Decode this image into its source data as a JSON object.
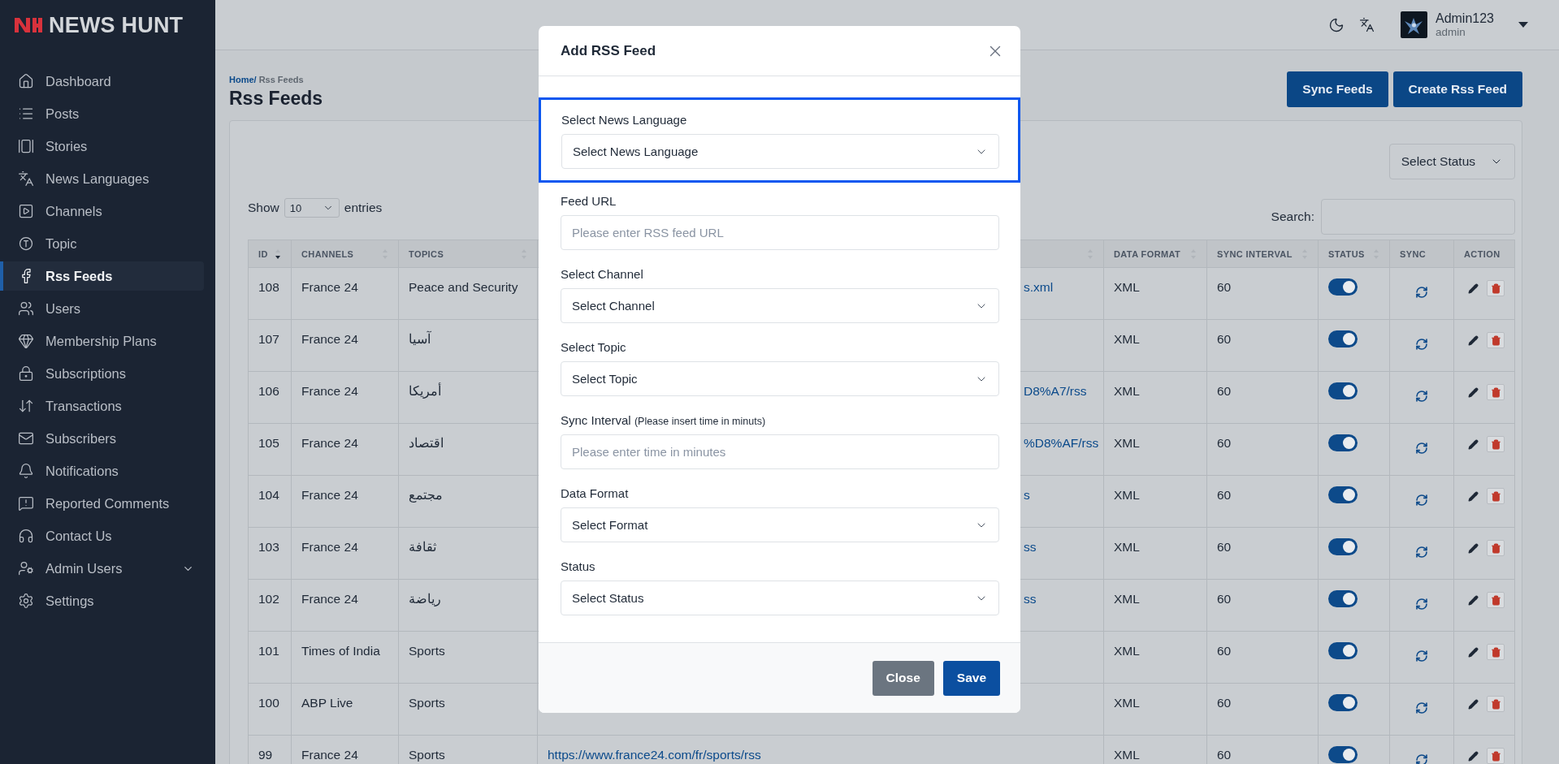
{
  "brand": {
    "name": "NEWS HUNT"
  },
  "sidebar": {
    "items": [
      {
        "label": "Dashboard",
        "selected": false,
        "kind": "link"
      },
      {
        "label": "Posts",
        "selected": false,
        "kind": "link"
      },
      {
        "label": "Stories",
        "selected": false,
        "kind": "link"
      },
      {
        "label": "News Languages",
        "selected": false,
        "kind": "link"
      },
      {
        "label": "Channels",
        "selected": false,
        "kind": "link"
      },
      {
        "label": "Topic",
        "selected": false,
        "kind": "link"
      },
      {
        "label": "Rss Feeds",
        "selected": true,
        "kind": "link"
      },
      {
        "label": "Users",
        "selected": false,
        "kind": "link"
      },
      {
        "label": "Membership Plans",
        "selected": false,
        "kind": "link"
      },
      {
        "label": "Subscriptions",
        "selected": false,
        "kind": "link"
      },
      {
        "label": "Transactions",
        "selected": false,
        "kind": "link"
      },
      {
        "label": "Subscribers",
        "selected": false,
        "kind": "link"
      },
      {
        "label": "Notifications",
        "selected": false,
        "kind": "link"
      },
      {
        "label": "Reported Comments",
        "selected": false,
        "kind": "link"
      },
      {
        "label": "Contact Us",
        "selected": false,
        "kind": "link"
      },
      {
        "label": "Admin Users",
        "selected": false,
        "kind": "group"
      },
      {
        "label": "Settings",
        "selected": false,
        "kind": "link"
      }
    ]
  },
  "user": {
    "name": "Admin123",
    "role": "admin"
  },
  "page": {
    "breadcrumb_home": "Home/",
    "breadcrumb_current": "Rss Feeds",
    "title": "Rss Feeds",
    "buttons": [
      "Sync Feeds",
      "Create Rss Feed"
    ]
  },
  "filters": {
    "status": "Select Status",
    "show_label": "Show",
    "entries_value": "10",
    "entries_label": "entries",
    "search_label": "Search:"
  },
  "table": {
    "columns": [
      {
        "label": "ID",
        "sortable": true,
        "sorted": true
      },
      {
        "label": "CHANNELS",
        "sortable": true,
        "sorted": false
      },
      {
        "label": "TOPICS",
        "sortable": true,
        "sorted": false
      },
      {
        "sortable": true,
        "sorted": false
      },
      {
        "label": "DATA FORMAT",
        "sortable": true,
        "sorted": false
      },
      {
        "label": "SYNC INTERVAL",
        "sortable": true,
        "sorted": false
      },
      {
        "label": "STATUS",
        "sortable": true,
        "sorted": false
      },
      {
        "label": "SYNC",
        "sortable": false
      },
      {
        "label": "ACTION",
        "sortable": false
      }
    ],
    "rows": [
      {
        "id": "108",
        "channel": "France 24",
        "topic": "Peace and Security",
        "url": {
          "text": "s.xml",
          "covered": true
        },
        "format": "XML",
        "interval": "60",
        "status": true
      },
      {
        "id": "107",
        "channel": "France 24",
        "topic": "آسيا",
        "format": "XML",
        "interval": "60",
        "status": true
      },
      {
        "id": "106",
        "channel": "France 24",
        "topic": "أمريكا",
        "url": {
          "text": "D8%A7/rss",
          "covered": true
        },
        "format": "XML",
        "interval": "60",
        "status": true
      },
      {
        "id": "105",
        "channel": "France 24",
        "topic": "اقتصاد",
        "url": {
          "text": "%D8%AF/rss",
          "covered": true
        },
        "format": "XML",
        "interval": "60",
        "status": true
      },
      {
        "id": "104",
        "channel": "France 24",
        "topic": "مجتمع",
        "url": {
          "text": "s",
          "covered": true
        },
        "format": "XML",
        "interval": "60",
        "status": true
      },
      {
        "id": "103",
        "channel": "France 24",
        "topic": "ثقافة",
        "url": {
          "text": "ss",
          "covered": true
        },
        "format": "XML",
        "interval": "60",
        "status": true
      },
      {
        "id": "102",
        "channel": "France 24",
        "topic": "رياضة",
        "url": {
          "text": "ss",
          "covered": true
        },
        "format": "XML",
        "interval": "60",
        "status": true
      },
      {
        "id": "101",
        "channel": "Times of India",
        "topic": "Sports",
        "format": "XML",
        "interval": "60",
        "status": true
      },
      {
        "id": "100",
        "channel": "ABP Live",
        "topic": "Sports",
        "format": "XML",
        "interval": "60",
        "status": true
      },
      {
        "id": "99",
        "channel": "France 24",
        "topic": "Sports",
        "url": {
          "text": "https://www.france24.com/fr/sports/rss",
          "covered": false
        },
        "format": "XML",
        "interval": "60",
        "status": true
      }
    ]
  },
  "dialog": {
    "title": "Add RSS Feed",
    "fields": [
      {
        "kind": "select",
        "label": "Select News Language",
        "value": "Select News Language",
        "focused": true
      },
      {
        "kind": "input",
        "label": "Feed URL",
        "placeholder": "Please enter RSS feed URL",
        "focused": false
      },
      {
        "kind": "select",
        "label": "Select Channel",
        "value": "Select Channel",
        "focused": false
      },
      {
        "kind": "select",
        "label": "Select Topic",
        "value": "Select Topic",
        "focused": false
      },
      {
        "kind": "input",
        "label": "Sync Interval",
        "hint": "(Please insert time in minuts)",
        "placeholder": "Please enter time in minutes",
        "focused": false
      },
      {
        "kind": "select",
        "label": "Data Format",
        "value": "Select Format",
        "focused": false
      },
      {
        "kind": "select",
        "label": "Status",
        "value": "Select Status",
        "focused": false
      }
    ],
    "buttons": [
      {
        "label": "Close",
        "kind": "secondary"
      },
      {
        "label": "Save",
        "kind": "primary"
      }
    ]
  }
}
